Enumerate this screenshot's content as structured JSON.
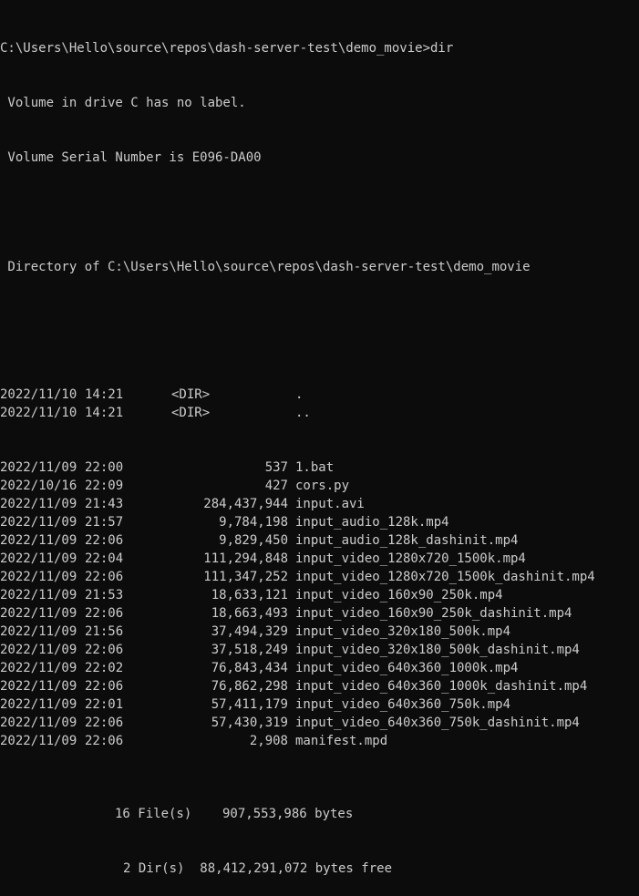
{
  "prompt": "C:\\Users\\Hello\\source\\repos\\dash-server-test\\demo_movie>dir",
  "volume_label": " Volume in drive C has no label.",
  "volume_serial": " Volume Serial Number is E096-DA00",
  "directory_of": " Directory of C:\\Users\\Hello\\source\\repos\\dash-server-test\\demo_movie",
  "dir_entries": [
    {
      "date": "2022/11/10",
      "time": "14:21",
      "tag": "<DIR>",
      "name": "."
    },
    {
      "date": "2022/11/10",
      "time": "14:21",
      "tag": "<DIR>",
      "name": ".."
    }
  ],
  "file_entries": [
    {
      "date": "2022/11/09",
      "time": "22:00",
      "size": "537",
      "name": "1.bat"
    },
    {
      "date": "2022/10/16",
      "time": "22:09",
      "size": "427",
      "name": "cors.py"
    },
    {
      "date": "2022/11/09",
      "time": "21:43",
      "size": "284,437,944",
      "name": "input.avi"
    },
    {
      "date": "2022/11/09",
      "time": "21:57",
      "size": "9,784,198",
      "name": "input_audio_128k.mp4"
    },
    {
      "date": "2022/11/09",
      "time": "22:06",
      "size": "9,829,450",
      "name": "input_audio_128k_dashinit.mp4"
    },
    {
      "date": "2022/11/09",
      "time": "22:04",
      "size": "111,294,848",
      "name": "input_video_1280x720_1500k.mp4"
    },
    {
      "date": "2022/11/09",
      "time": "22:06",
      "size": "111,347,252",
      "name": "input_video_1280x720_1500k_dashinit.mp4"
    },
    {
      "date": "2022/11/09",
      "time": "21:53",
      "size": "18,633,121",
      "name": "input_video_160x90_250k.mp4"
    },
    {
      "date": "2022/11/09",
      "time": "22:06",
      "size": "18,663,493",
      "name": "input_video_160x90_250k_dashinit.mp4"
    },
    {
      "date": "2022/11/09",
      "time": "21:56",
      "size": "37,494,329",
      "name": "input_video_320x180_500k.mp4"
    },
    {
      "date": "2022/11/09",
      "time": "22:06",
      "size": "37,518,249",
      "name": "input_video_320x180_500k_dashinit.mp4"
    },
    {
      "date": "2022/11/09",
      "time": "22:02",
      "size": "76,843,434",
      "name": "input_video_640x360_1000k.mp4"
    },
    {
      "date": "2022/11/09",
      "time": "22:06",
      "size": "76,862,298",
      "name": "input_video_640x360_1000k_dashinit.mp4"
    },
    {
      "date": "2022/11/09",
      "time": "22:01",
      "size": "57,411,179",
      "name": "input_video_640x360_750k.mp4"
    },
    {
      "date": "2022/11/09",
      "time": "22:06",
      "size": "57,430,319",
      "name": "input_video_640x360_750k_dashinit.mp4"
    },
    {
      "date": "2022/11/09",
      "time": "22:06",
      "size": "2,908",
      "name": "manifest.mpd"
    }
  ],
  "summary": {
    "files": "16 File(s)    907,553,986 bytes",
    "dirs": "2 Dir(s)  88,412,291,072 bytes free"
  },
  "colors": {
    "background": "#0c0c0c",
    "foreground": "#cccccc"
  }
}
